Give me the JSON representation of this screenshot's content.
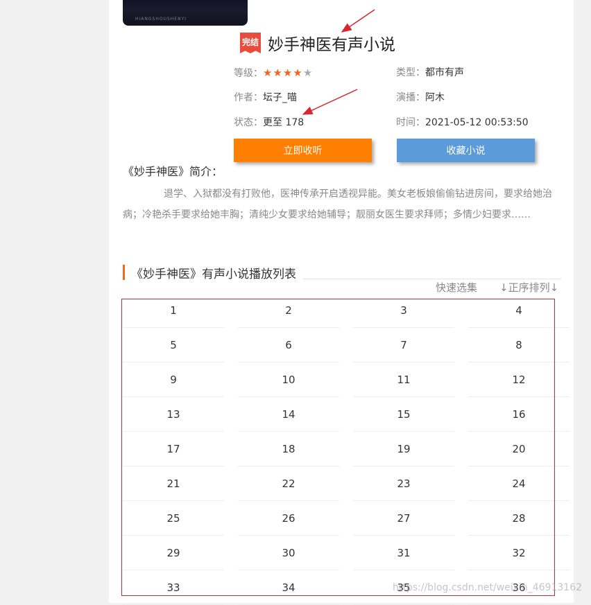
{
  "cover": {
    "caption": "HIANGSHOUSHENYI"
  },
  "novel": {
    "badge": "完结",
    "title": "妙手神医有声小说",
    "rating_label": "等级：",
    "rating": 4,
    "rating_max": 5,
    "type_label": "类型：",
    "type": "都市有声",
    "author_label": "作者：",
    "author": "坛子_喵",
    "narrator_label": "演播：",
    "narrator": "阿木",
    "status_label": "状态：",
    "status": "更至 178",
    "time_label": "时间：",
    "time": "2021-05-12 00:53:50"
  },
  "actions": {
    "listen": "立即收听",
    "favorite": "收藏小说"
  },
  "intro": {
    "title": "《妙手神医》简介：",
    "text": "退学、入狱都没有打败他，医神传承开启透视异能。美女老板娘偷偷钻进房间，要求给她治病；冷艳杀手要求给她丰胸；清纯少女要求给她辅导；靓丽女医生要求拜师；多情少妇要求……"
  },
  "playlist": {
    "title": "《妙手神医》有声小说播放列表",
    "quick_select": "快速选集",
    "sort_order": "↓正序排列↓",
    "episodes": [
      "1",
      "2",
      "3",
      "4",
      "5",
      "6",
      "7",
      "8",
      "9",
      "10",
      "11",
      "12",
      "13",
      "14",
      "15",
      "16",
      "17",
      "18",
      "19",
      "20",
      "21",
      "22",
      "23",
      "24",
      "25",
      "26",
      "27",
      "28",
      "29",
      "30",
      "31",
      "32",
      "33",
      "34",
      "35",
      "36"
    ]
  },
  "watermark": "https://blog.csdn.net/weixin_46913162",
  "colors": {
    "accent_orange": "#ff7f00",
    "accent_blue": "#5b9bd9",
    "annotation_red": "#d9252b",
    "star": "#f26522"
  }
}
